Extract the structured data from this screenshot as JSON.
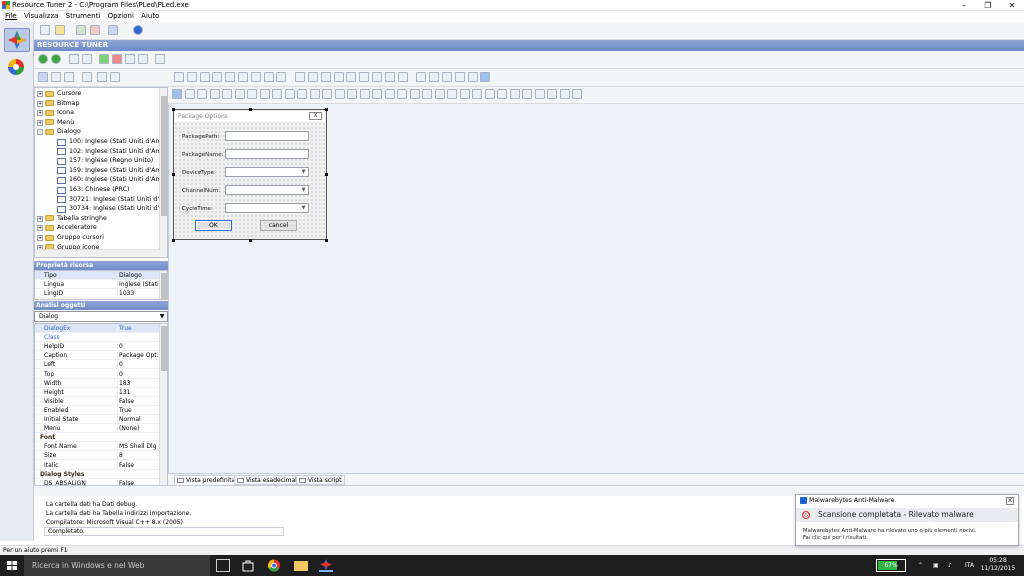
{
  "window": {
    "title": "Resource Tuner 2 - C:\\Program Files\\PLed\\PLed.exe"
  },
  "menu": [
    "File",
    "Visualizza",
    "Strumenti",
    "Opzioni",
    "Aiuto"
  ],
  "banner": "RESOURCE TUNER",
  "tree": {
    "items": [
      {
        "label": "Cursore",
        "level": 0,
        "kind": "folder",
        "exp": "+"
      },
      {
        "label": "Bitmap",
        "level": 0,
        "kind": "folder",
        "exp": "+"
      },
      {
        "label": "Icona",
        "level": 0,
        "kind": "folder",
        "exp": "+"
      },
      {
        "label": "Menù",
        "level": 0,
        "kind": "folder",
        "exp": "+"
      },
      {
        "label": "Dialogo",
        "level": 0,
        "kind": "folder",
        "exp": "-"
      },
      {
        "label": "100: Inglese (Stati Uniti d'America",
        "level": 1,
        "kind": "dialog"
      },
      {
        "label": "102: Inglese (Stati Uniti d'America",
        "level": 1,
        "kind": "dialog"
      },
      {
        "label": "157: Inglese (Regno Unito)",
        "level": 1,
        "kind": "dialog"
      },
      {
        "label": "159: Inglese (Stati Uniti d'America",
        "level": 1,
        "kind": "dialog"
      },
      {
        "label": "160: Inglese (Stati Uniti d'America",
        "level": 1,
        "kind": "dialog"
      },
      {
        "label": "163: Chinese (PRC)",
        "level": 1,
        "kind": "dialog"
      },
      {
        "label": "30721: Inglese (Stati Uniti d'Amer",
        "level": 1,
        "kind": "dialog"
      },
      {
        "label": "30734: Inglese (Stati Uniti d'Amer",
        "level": 1,
        "kind": "dialog"
      },
      {
        "label": "Tabella stringhe",
        "level": 0,
        "kind": "folder",
        "exp": "+"
      },
      {
        "label": "Acceleratore",
        "level": 0,
        "kind": "folder",
        "exp": "+"
      },
      {
        "label": "Gruppo cursori",
        "level": 0,
        "kind": "folder",
        "exp": "+"
      },
      {
        "label": "Gruppo icone",
        "level": 0,
        "kind": "folder",
        "exp": "+"
      }
    ]
  },
  "resource_props": {
    "header": "Proprietà risorsa",
    "rows": [
      {
        "k": "Tipo",
        "v": "Dialogo",
        "sel": true
      },
      {
        "k": "Lingua",
        "v": "Inglese (Stati..."
      },
      {
        "k": "LingID",
        "v": "1033"
      }
    ]
  },
  "object_analysis": {
    "header": "Analisi oggetti",
    "selected": "Dialog",
    "rows": [
      {
        "k": "DialogEx",
        "v": "True",
        "blue": true,
        "sel": true
      },
      {
        "k": "Class",
        "v": "",
        "blue": true
      },
      {
        "k": "HelpID",
        "v": "0"
      },
      {
        "k": "Caption",
        "v": "Package Opt..."
      },
      {
        "k": "Left",
        "v": "0"
      },
      {
        "k": "Top",
        "v": "0"
      },
      {
        "k": "Width",
        "v": "183"
      },
      {
        "k": "Height",
        "v": "131"
      },
      {
        "k": "Visible",
        "v": "False"
      },
      {
        "k": "Enabled",
        "v": "True"
      },
      {
        "k": "Initial State",
        "v": "Normal"
      },
      {
        "k": "Menu",
        "v": "(None)"
      },
      {
        "k": "Font",
        "v": "",
        "cat": true
      },
      {
        "k": "Font Name",
        "v": "MS Shell Dlg"
      },
      {
        "k": "Size",
        "v": "8"
      },
      {
        "k": "Italic",
        "v": "False"
      },
      {
        "k": "Dialog Styles",
        "v": "",
        "cat": true
      },
      {
        "k": "DS_ABSALIGN",
        "v": "False"
      }
    ]
  },
  "dialog": {
    "caption": "Package Options",
    "close": "X",
    "fields": [
      {
        "label": "PackagePath:",
        "type": "edit"
      },
      {
        "label": "PackageName:",
        "type": "edit"
      },
      {
        "label": "DeviceType:",
        "type": "combo"
      },
      {
        "label": "ChannelNum:",
        "type": "combo"
      },
      {
        "label": "CycleTime:",
        "type": "combo"
      }
    ],
    "ok": "OK",
    "cancel": "cancel"
  },
  "view_tabs": [
    "Vista predefinita",
    "Vista esadecimale",
    "Vista script"
  ],
  "output": {
    "lines": [
      "La cartella dati ha Dati debug.",
      "La cartella dati ha Tabella indirizzi importazione.",
      "Compilatore: Microsoft Visual C++ 8.x (2005)"
    ],
    "progress": "Completato."
  },
  "status": "Per un aiuto premi F1",
  "notification": {
    "app": "Malwarebytes Anti-Malware",
    "title": "Scansione completata - Rilevato malware",
    "message_line1": "Malwarebytes Anti-Malware ha rilevato uno o più elementi nocivi.",
    "message_line2": "Fai clic qui per i risultati.",
    "close": "X"
  },
  "taskbar": {
    "search_placeholder": "Ricerca in Windows e nel Web",
    "battery": "67%",
    "language": "ITA",
    "time": "05:28",
    "date": "11/12/2015"
  },
  "colors": {
    "banner": "#7f97cf",
    "workspace": "#eef2fa",
    "taskbar": "#1e1e1e",
    "accent": "#2a6fd4"
  }
}
